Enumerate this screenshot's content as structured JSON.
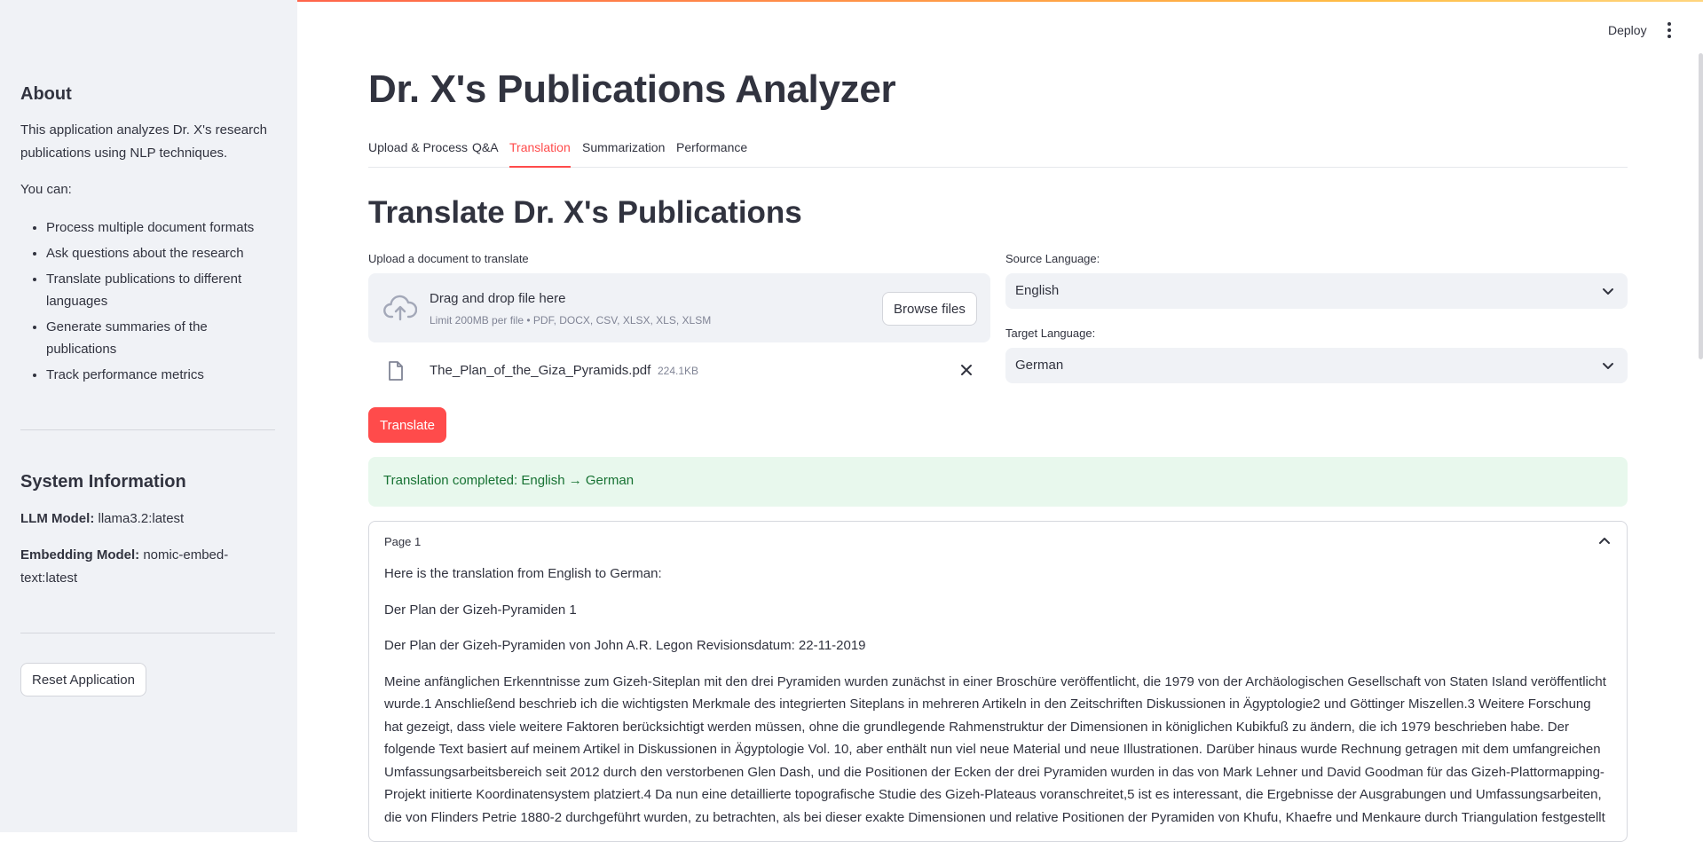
{
  "sidebar": {
    "about_heading": "About",
    "about_text": "This application analyzes Dr. X's research publications using NLP techniques.",
    "you_can": "You can:",
    "features": [
      "Process multiple document formats",
      "Ask questions about the research",
      "Translate publications to different languages",
      "Generate summaries of the publications",
      "Track performance metrics"
    ],
    "system_heading": "System Information",
    "llm_label": "LLM Model:",
    "llm_value": "llama3.2:latest",
    "embed_label": "Embedding Model:",
    "embed_value": "nomic-embed-text:latest",
    "reset_label": "Reset Application"
  },
  "header": {
    "deploy_label": "Deploy",
    "menu_icon": "kebab-menu-icon"
  },
  "main": {
    "title": "Dr. X's Publications Analyzer",
    "tabs": [
      {
        "label": "Upload & Process",
        "active": false
      },
      {
        "label": "Q&A",
        "active": false
      },
      {
        "label": "Translation",
        "active": true
      },
      {
        "label": "Summarization",
        "active": false
      },
      {
        "label": "Performance",
        "active": false
      }
    ],
    "section_title": "Translate Dr. X's Publications",
    "upload": {
      "label": "Upload a document to translate",
      "dropzone_title": "Drag and drop file here",
      "dropzone_hint": "Limit 200MB per file • PDF, DOCX, CSV, XLSX, XLS, XLSM",
      "browse_label": "Browse files",
      "file_name": "The_Plan_of_the_Giza_Pyramids.pdf",
      "file_size": "224.1KB"
    },
    "source_language": {
      "label": "Source Language:",
      "value": "English"
    },
    "target_language": {
      "label": "Target Language:",
      "value": "German"
    },
    "translate_label": "Translate",
    "success_message": "Translation completed: English → German",
    "result": {
      "page_label": "Page 1",
      "paragraphs": [
        "Here is the translation from English to German:",
        "Der Plan der Gizeh-Pyramiden 1",
        "Der Plan der Gizeh-Pyramiden von John A.R. Legon Revisionsdatum: 22-11-2019",
        "Meine anfänglichen Erkenntnisse zum Gizeh-Siteplan mit den drei Pyramiden wurden zunächst in einer Broschüre veröffentlicht, die 1979 von der Archäologischen Gesellschaft von Staten Island veröffentlicht wurde.1 Anschließend beschrieb ich die wichtigsten Merkmale des integrierten Siteplans in mehreren Artikeln in den Zeitschriften Diskussionen in Ägyptologie2 und Göttinger Miszellen.3 Weitere Forschung hat gezeigt, dass viele weitere Faktoren berücksichtigt werden müssen, ohne die grundlegende Rahmenstruktur der Dimensionen in königlichen Kubikfuß zu ändern, die ich 1979 beschrieben habe. Der folgende Text basiert auf meinem Artikel in Diskussionen in Ägyptologie Vol. 10, aber enthält nun viel neue Material und neue Illustrationen. Darüber hinaus wurde Rechnung getragen mit dem umfangreichen Umfassungsarbeitsbereich seit 2012 durch den verstorbenen Glen Dash, und die Positionen der Ecken der drei Pyramiden wurden in das von Mark Lehner und David Goodman für das Gizeh-Plattormapping-Projekt initierte Koordinatensystem platziert.4 Da nun eine detaillierte topografische Studie des Gizeh-Plateaus voranschreitet,5 ist es interessant, die Ergebnisse der Ausgrabungen und Umfassungsarbeiten, die von Flinders Petrie 1880-2 durchgeführt wurden, zu betrachten, als bei dieser exakte Dimensionen und relative Positionen der Pyramiden von Khufu, Khaefre und Menkaure durch Triangulation festgestellt"
      ]
    }
  },
  "colors": {
    "accent": "#ff4b4b",
    "sidebar_bg": "#f0f2f6",
    "success_bg": "#e8f8ed",
    "success_text": "#177233"
  }
}
